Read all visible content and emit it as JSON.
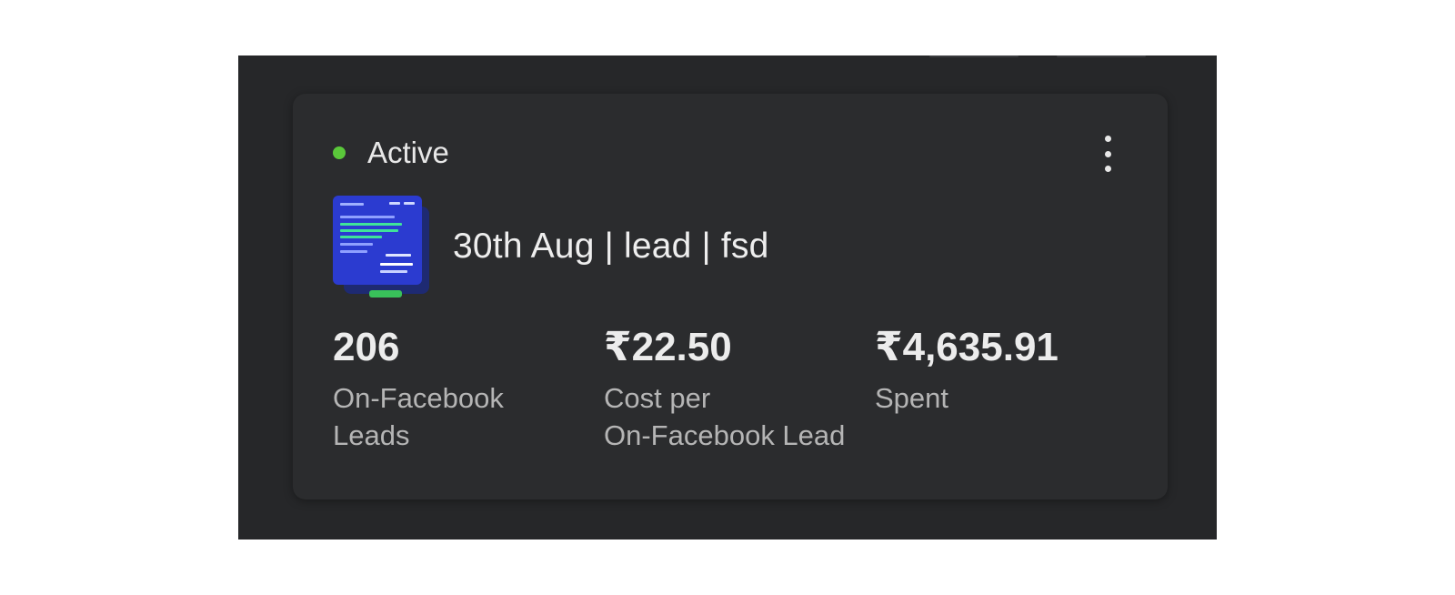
{
  "campaign": {
    "status": "Active",
    "status_color": "#5ac83a",
    "title": "30th Aug | lead | fsd",
    "thumbnail_icon": "ad-creative-thumbnail",
    "menu_icon": "more-vertical-icon"
  },
  "metrics": [
    {
      "value": "206",
      "label_line1": "On-Facebook",
      "label_line2": "Leads"
    },
    {
      "value": "₹22.50",
      "label_line1": "Cost per",
      "label_line2": "On-Facebook Lead"
    },
    {
      "value": "₹4,635.91",
      "label_line1": "Spent",
      "label_line2": ""
    }
  ]
}
